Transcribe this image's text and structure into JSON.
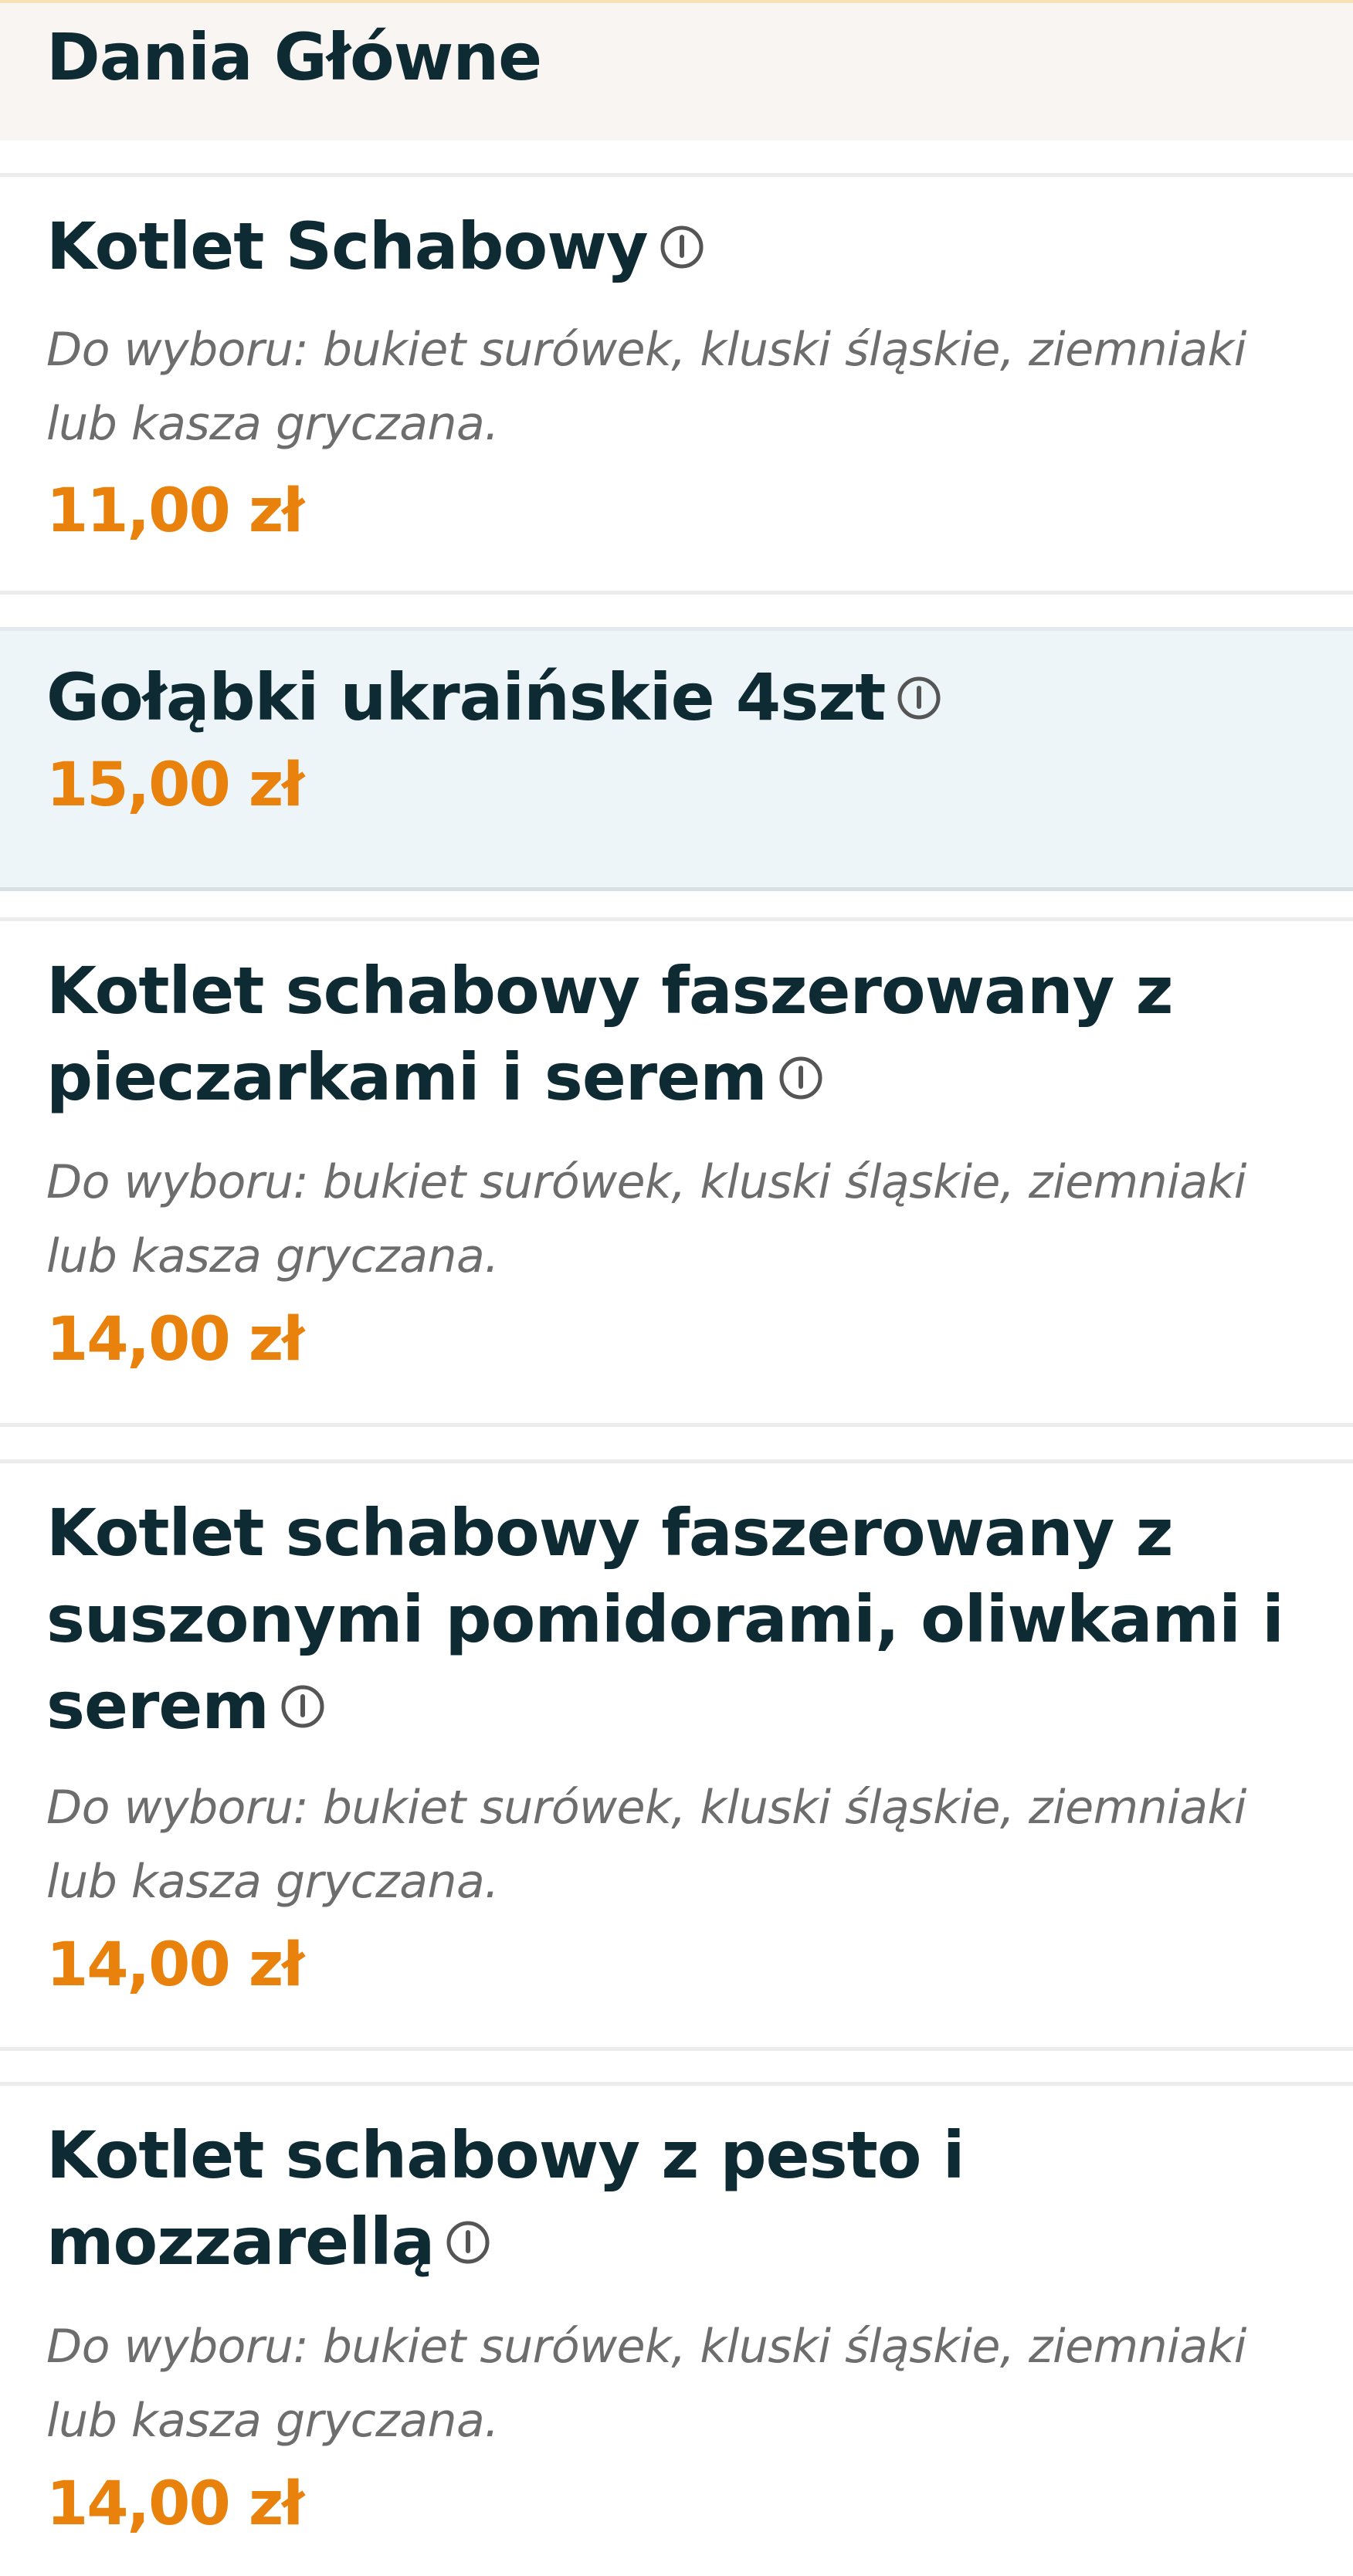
{
  "category": {
    "title": "Dania Główne"
  },
  "items": [
    {
      "name": "Kotlet Schabowy",
      "description": "Do wyboru: bukiet surówek, kluski śląskie, ziemniaki lub kasza gryczana.",
      "price": "11,00 zł",
      "icon": "info-icon"
    },
    {
      "name": "Gołąbki ukraińskie 4szt",
      "price": "15,00 zł",
      "icon": "info-icon"
    },
    {
      "name": "Kotlet schabowy faszerowany z pieczarkami i serem",
      "description": "Do wyboru: bukiet surówek, kluski śląskie, ziemniaki lub kasza gryczana.",
      "price": "14,00 zł",
      "icon": "info-icon"
    },
    {
      "name": "Kotlet schabowy faszerowany z suszonymi pomidorami, oliwkami i serem",
      "description": "Do wyboru: bukiet surówek, kluski śląskie, ziemniaki lub kasza gryczana.",
      "price": "14,00 zł",
      "icon": "info-icon"
    },
    {
      "name": "Kotlet schabowy z pesto i mozzarellą",
      "description": "Do wyboru: bukiet surówek, kluski śląskie, ziemniaki lub kasza gryczana.",
      "price": "14,00 zł",
      "icon": "info-icon"
    }
  ],
  "colors": {
    "title": "#0e2a33",
    "price": "#e8820c",
    "description": "#6d6d6d",
    "header_background": "#f8f5f2",
    "highlight_background": "#edf5f8"
  }
}
